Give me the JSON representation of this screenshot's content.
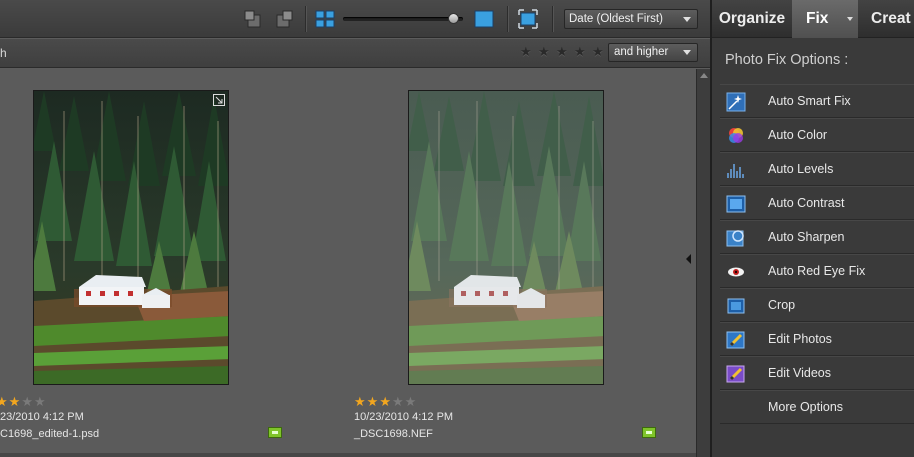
{
  "toolbar": {
    "sort_value": "Date (Oldest First)",
    "thumbnail_size": 0.8,
    "icons": [
      "rotate-left-icon",
      "rotate-right-icon",
      "small-thumbnails-icon",
      "large-thumbnails-icon",
      "full-screen-icon"
    ]
  },
  "filter": {
    "truncated_label": "h",
    "stars_filter": 0,
    "rating_option": "and higher"
  },
  "photos": [
    {
      "rating": 3,
      "date": "23/2010 4:12 PM",
      "filename": "C1698_edited-1.psd",
      "stacked": true
    },
    {
      "rating": 3,
      "date": "10/23/2010 4:12 PM",
      "filename": "_DSC1698.NEF",
      "stacked": false
    }
  ],
  "tabs": {
    "organize": "Organize",
    "fix": "Fix",
    "create": "Creat"
  },
  "panel": {
    "title": "Photo Fix Options :",
    "items": [
      {
        "label": "Auto Smart Fix",
        "icon": "auto-smart-fix-icon"
      },
      {
        "label": "Auto Color",
        "icon": "auto-color-icon"
      },
      {
        "label": "Auto Levels",
        "icon": "auto-levels-icon"
      },
      {
        "label": "Auto Contrast",
        "icon": "auto-contrast-icon"
      },
      {
        "label": "Auto Sharpen",
        "icon": "auto-sharpen-icon"
      },
      {
        "label": "Auto Red Eye Fix",
        "icon": "red-eye-icon"
      },
      {
        "label": "Crop",
        "icon": "crop-icon"
      },
      {
        "label": "Edit Photos",
        "icon": "edit-photos-icon"
      },
      {
        "label": "Edit Videos",
        "icon": "edit-videos-icon"
      },
      {
        "label": "More Options",
        "icon": ""
      }
    ]
  },
  "colors": {
    "accent_star": "#f2a61f",
    "badge_green": "#7fc42a",
    "active_tab": "#5a5a5a"
  }
}
